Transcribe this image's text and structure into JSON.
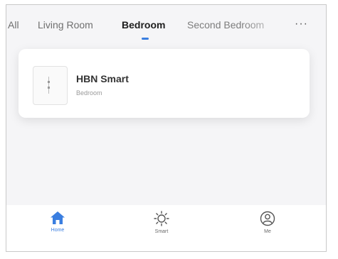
{
  "tabs": [
    {
      "label": "All",
      "active": false
    },
    {
      "label": "Living Room",
      "active": false
    },
    {
      "label": "Bedroom",
      "active": true
    },
    {
      "label": "Second Bedroom",
      "active": false
    }
  ],
  "more_label": "···",
  "device": {
    "name": "HBN Smart",
    "room": "Bedroom",
    "icon": "smart-plug-icon"
  },
  "bottom_nav": [
    {
      "label": "Home",
      "icon": "home-icon",
      "active": true
    },
    {
      "label": "Smart",
      "icon": "sun-icon",
      "active": false
    },
    {
      "label": "Me",
      "icon": "user-icon",
      "active": false
    }
  ],
  "colors": {
    "accent": "#3a7ee0",
    "background": "#f5f5f7",
    "card": "#ffffff"
  }
}
